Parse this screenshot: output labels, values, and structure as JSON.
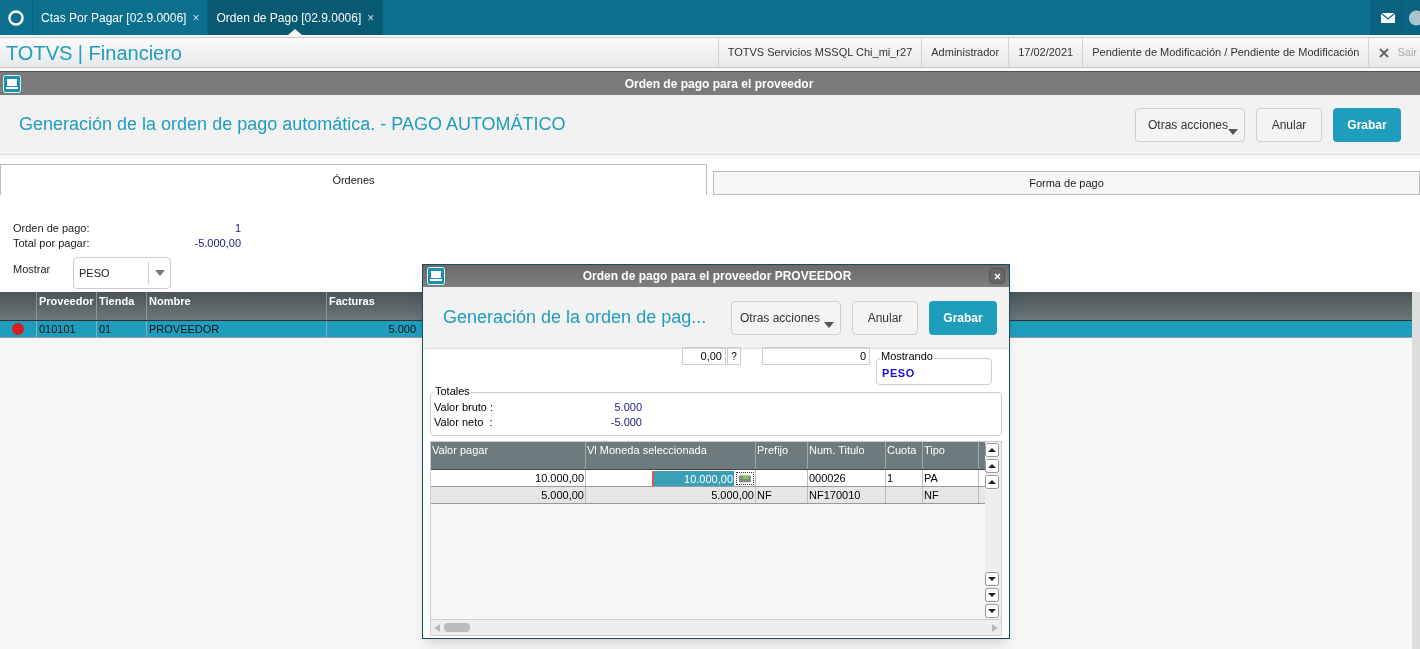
{
  "app_tabs": [
    {
      "label": "Ctas Por Pagar [02.9.0006]",
      "close": "×",
      "selected": false
    },
    {
      "label": "Orden de Pago [02.9.0006]",
      "close": "×",
      "selected": true
    }
  ],
  "header": {
    "brand": "TOTVS | Financiero",
    "items": [
      "TOTVS Servicios MSSQL Chi_mi_r27",
      "Administrador",
      "17/02/2021",
      "Pendiente de Modificación / Pendiente de Modificación"
    ],
    "exit": "Sair"
  },
  "window": {
    "title": "Orden de pago para el proveedor"
  },
  "page": {
    "title": "Generación de la orden de pago automática. - PAGO AUTOMÁTICO",
    "buttons": [
      {
        "label": "Otras acciones",
        "kind": "menu"
      },
      {
        "label": "Anular",
        "kind": "plain"
      },
      {
        "label": "Grabar",
        "kind": "primary"
      }
    ]
  },
  "tabs": [
    {
      "label": "Órdenes",
      "selected": true
    },
    {
      "label": "Forma de pago",
      "selected": false
    }
  ],
  "summary": [
    {
      "label": "Orden de pago:",
      "value": "1"
    },
    {
      "label": "Total por pagar:",
      "value": "-5.000,00"
    }
  ],
  "mostrar": {
    "label": "Mostrar",
    "value": "PESO"
  },
  "table": {
    "columns": [
      "",
      "Proveedor",
      "Tienda",
      "Nombre",
      "Facturas"
    ],
    "rows": [
      {
        "selected": true,
        "color": "#d81e1e",
        "cells": [
          "",
          "010101",
          "01",
          "PROVEEDOR",
          "5.000"
        ]
      }
    ]
  },
  "dialog": {
    "title": "Orden de pago para el proveedor PROVEEDOR",
    "heading": "Generación de la orden de pag...",
    "buttons": [
      {
        "label": "Otras acciones",
        "kind": "menu"
      },
      {
        "label": "Anular",
        "kind": "plain"
      },
      {
        "label": "Grabar",
        "kind": "primary"
      }
    ],
    "amount": "0,00",
    "help": "?",
    "count": "0",
    "mostrando": {
      "legend": "Mostrando",
      "value": "PESO"
    },
    "totales": {
      "legend": "Totales",
      "rows": [
        {
          "label": "Valor bruto :",
          "value": "5.000"
        },
        {
          "label": "Valor neto  :",
          "value": "-5.000"
        }
      ]
    },
    "grid": {
      "columns": [
        "Valor pagar",
        "Vl Moneda seleccionada",
        "Prefijo",
        "Num. Titulo",
        "Cuota",
        "Tipo"
      ],
      "rows": [
        {
          "editing": true,
          "cells": [
            "10.000,00",
            "10.000,00",
            "",
            "000026",
            "1",
            "PA"
          ]
        },
        {
          "editing": false,
          "cells": [
            "5.000,00",
            "5.000,00",
            "NF",
            "NF170010",
            "",
            "NF"
          ]
        }
      ]
    }
  }
}
